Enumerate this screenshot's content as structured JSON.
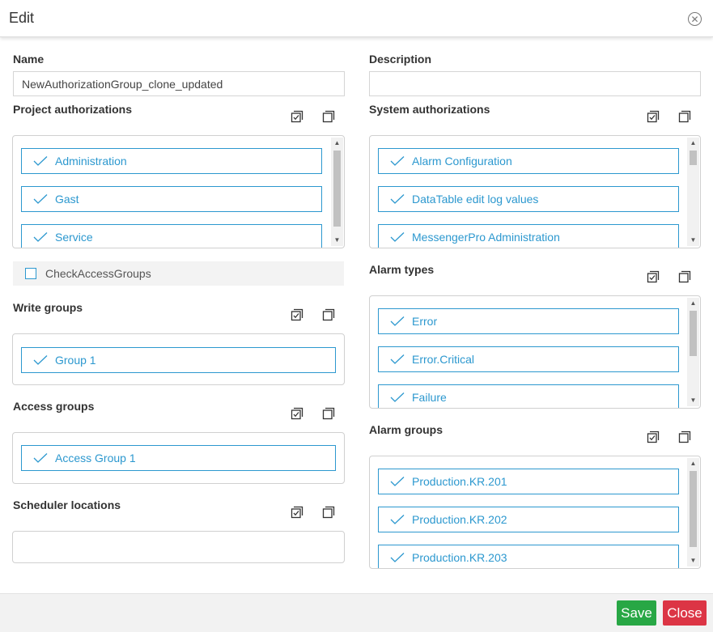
{
  "dialog": {
    "title": "Edit",
    "close_symbol": "✕"
  },
  "name": {
    "label": "Name",
    "value": "NewAuthorizationGroup_clone_updated"
  },
  "description": {
    "label": "Description",
    "value": ""
  },
  "project_authorizations": {
    "label": "Project authorizations",
    "items": [
      "Administration",
      "Gast",
      "Service"
    ]
  },
  "system_authorizations": {
    "label": "System authorizations",
    "items": [
      "Alarm Configuration",
      "DataTable edit log values",
      "MessengerPro Administration"
    ]
  },
  "check_access_groups": {
    "label": "CheckAccessGroups",
    "checked": false
  },
  "alarm_types": {
    "label": "Alarm types",
    "items": [
      "Error",
      "Error.Critical",
      "Failure"
    ]
  },
  "write_groups": {
    "label": "Write groups",
    "items": [
      "Group 1"
    ]
  },
  "access_groups": {
    "label": "Access groups",
    "items": [
      "Access Group 1"
    ]
  },
  "alarm_groups": {
    "label": "Alarm groups",
    "items": [
      "Production.KR.201",
      "Production.KR.202",
      "Production.KR.203"
    ]
  },
  "scheduler_locations": {
    "label": "Scheduler locations",
    "items": []
  },
  "footer": {
    "save_label": "Save",
    "close_label": "Close"
  },
  "icons": {
    "select_all": "select-all-icon",
    "copy": "copy-icon",
    "check": "check-icon"
  },
  "colors": {
    "accent": "#2c98cf",
    "save": "#28a745",
    "close": "#dc3545"
  }
}
